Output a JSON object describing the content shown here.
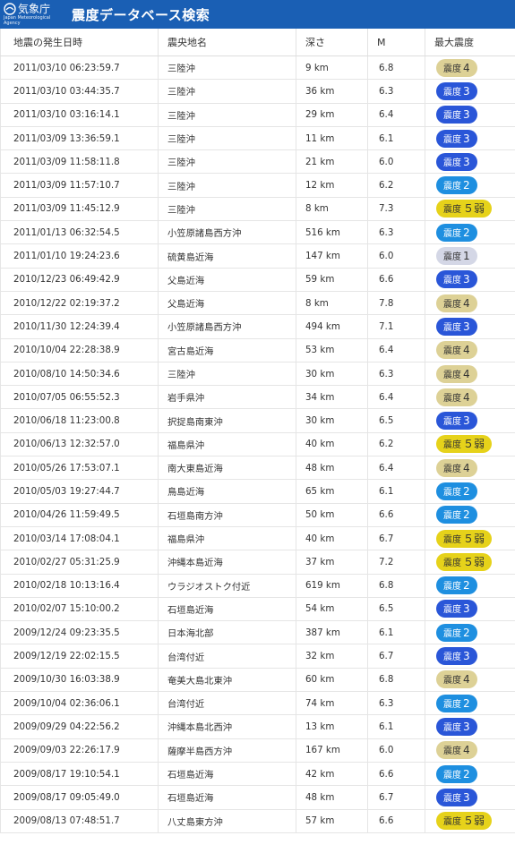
{
  "header": {
    "logo_text": "気象庁",
    "logo_sub": "Japan Meteorological Agency",
    "title": "震度データベース検索"
  },
  "table": {
    "columns": [
      "地震の発生日時",
      "震央地名",
      "深さ",
      "M",
      "最大震度"
    ],
    "rows": [
      {
        "datetime": "2011/03/10 06:23:59.7",
        "place": "三陸沖",
        "depth": "9 km",
        "mag": "6.8",
        "int_prefix": "震度",
        "int_num": "4",
        "level": 4
      },
      {
        "datetime": "2011/03/10 03:44:35.7",
        "place": "三陸沖",
        "depth": "36 km",
        "mag": "6.3",
        "int_prefix": "震度",
        "int_num": "3",
        "level": 3
      },
      {
        "datetime": "2011/03/10 03:16:14.1",
        "place": "三陸沖",
        "depth": "29 km",
        "mag": "6.4",
        "int_prefix": "震度",
        "int_num": "3",
        "level": 3
      },
      {
        "datetime": "2011/03/09 13:36:59.1",
        "place": "三陸沖",
        "depth": "11 km",
        "mag": "6.1",
        "int_prefix": "震度",
        "int_num": "3",
        "level": 3
      },
      {
        "datetime": "2011/03/09 11:58:11.8",
        "place": "三陸沖",
        "depth": "21 km",
        "mag": "6.0",
        "int_prefix": "震度",
        "int_num": "3",
        "level": 3
      },
      {
        "datetime": "2011/03/09 11:57:10.7",
        "place": "三陸沖",
        "depth": "12 km",
        "mag": "6.2",
        "int_prefix": "震度",
        "int_num": "2",
        "level": 2
      },
      {
        "datetime": "2011/03/09 11:45:12.9",
        "place": "三陸沖",
        "depth": "8 km",
        "mag": "7.3",
        "int_prefix": "震度",
        "int_num": "５弱",
        "level": 5
      },
      {
        "datetime": "2011/01/13 06:32:54.5",
        "place": "小笠原諸島西方沖",
        "depth": "516 km",
        "mag": "6.3",
        "int_prefix": "震度",
        "int_num": "2",
        "level": 2
      },
      {
        "datetime": "2011/01/10 19:24:23.6",
        "place": "硫黄島近海",
        "depth": "147 km",
        "mag": "6.0",
        "int_prefix": "震度",
        "int_num": "1",
        "level": 1
      },
      {
        "datetime": "2010/12/23 06:49:42.9",
        "place": "父島近海",
        "depth": "59 km",
        "mag": "6.6",
        "int_prefix": "震度",
        "int_num": "3",
        "level": 3
      },
      {
        "datetime": "2010/12/22 02:19:37.2",
        "place": "父島近海",
        "depth": "8 km",
        "mag": "7.8",
        "int_prefix": "震度",
        "int_num": "4",
        "level": 4
      },
      {
        "datetime": "2010/11/30 12:24:39.4",
        "place": "小笠原諸島西方沖",
        "depth": "494 km",
        "mag": "7.1",
        "int_prefix": "震度",
        "int_num": "3",
        "level": 3
      },
      {
        "datetime": "2010/10/04 22:28:38.9",
        "place": "宮古島近海",
        "depth": "53 km",
        "mag": "6.4",
        "int_prefix": "震度",
        "int_num": "4",
        "level": 4
      },
      {
        "datetime": "2010/08/10 14:50:34.6",
        "place": "三陸沖",
        "depth": "30 km",
        "mag": "6.3",
        "int_prefix": "震度",
        "int_num": "4",
        "level": 4
      },
      {
        "datetime": "2010/07/05 06:55:52.3",
        "place": "岩手県沖",
        "depth": "34 km",
        "mag": "6.4",
        "int_prefix": "震度",
        "int_num": "4",
        "level": 4
      },
      {
        "datetime": "2010/06/18 11:23:00.8",
        "place": "択捉島南東沖",
        "depth": "30 km",
        "mag": "6.5",
        "int_prefix": "震度",
        "int_num": "3",
        "level": 3
      },
      {
        "datetime": "2010/06/13 12:32:57.0",
        "place": "福島県沖",
        "depth": "40 km",
        "mag": "6.2",
        "int_prefix": "震度",
        "int_num": "５弱",
        "level": 5
      },
      {
        "datetime": "2010/05/26 17:53:07.1",
        "place": "南大東島近海",
        "depth": "48 km",
        "mag": "6.4",
        "int_prefix": "震度",
        "int_num": "4",
        "level": 4
      },
      {
        "datetime": "2010/05/03 19:27:44.7",
        "place": "鳥島近海",
        "depth": "65 km",
        "mag": "6.1",
        "int_prefix": "震度",
        "int_num": "2",
        "level": 2
      },
      {
        "datetime": "2010/04/26 11:59:49.5",
        "place": "石垣島南方沖",
        "depth": "50 km",
        "mag": "6.6",
        "int_prefix": "震度",
        "int_num": "2",
        "level": 2
      },
      {
        "datetime": "2010/03/14 17:08:04.1",
        "place": "福島県沖",
        "depth": "40 km",
        "mag": "6.7",
        "int_prefix": "震度",
        "int_num": "５弱",
        "level": 5
      },
      {
        "datetime": "2010/02/27 05:31:25.9",
        "place": "沖縄本島近海",
        "depth": "37 km",
        "mag": "7.2",
        "int_prefix": "震度",
        "int_num": "５弱",
        "level": 5
      },
      {
        "datetime": "2010/02/18 10:13:16.4",
        "place": "ウラジオストク付近",
        "depth": "619 km",
        "mag": "6.8",
        "int_prefix": "震度",
        "int_num": "2",
        "level": 2
      },
      {
        "datetime": "2010/02/07 15:10:00.2",
        "place": "石垣島近海",
        "depth": "54 km",
        "mag": "6.5",
        "int_prefix": "震度",
        "int_num": "3",
        "level": 3
      },
      {
        "datetime": "2009/12/24 09:23:35.5",
        "place": "日本海北部",
        "depth": "387 km",
        "mag": "6.1",
        "int_prefix": "震度",
        "int_num": "2",
        "level": 2
      },
      {
        "datetime": "2009/12/19 22:02:15.5",
        "place": "台湾付近",
        "depth": "32 km",
        "mag": "6.7",
        "int_prefix": "震度",
        "int_num": "3",
        "level": 3
      },
      {
        "datetime": "2009/10/30 16:03:38.9",
        "place": "奄美大島北東沖",
        "depth": "60 km",
        "mag": "6.8",
        "int_prefix": "震度",
        "int_num": "4",
        "level": 4
      },
      {
        "datetime": "2009/10/04 02:36:06.1",
        "place": "台湾付近",
        "depth": "74 km",
        "mag": "6.3",
        "int_prefix": "震度",
        "int_num": "2",
        "level": 2
      },
      {
        "datetime": "2009/09/29 04:22:56.2",
        "place": "沖縄本島北西沖",
        "depth": "13 km",
        "mag": "6.1",
        "int_prefix": "震度",
        "int_num": "3",
        "level": 3
      },
      {
        "datetime": "2009/09/03 22:26:17.9",
        "place": "薩摩半島西方沖",
        "depth": "167 km",
        "mag": "6.0",
        "int_prefix": "震度",
        "int_num": "4",
        "level": 4
      },
      {
        "datetime": "2009/08/17 19:10:54.1",
        "place": "石垣島近海",
        "depth": "42 km",
        "mag": "6.6",
        "int_prefix": "震度",
        "int_num": "2",
        "level": 2
      },
      {
        "datetime": "2009/08/17 09:05:49.0",
        "place": "石垣島近海",
        "depth": "48 km",
        "mag": "6.7",
        "int_prefix": "震度",
        "int_num": "3",
        "level": 3
      },
      {
        "datetime": "2009/08/13 07:48:51.7",
        "place": "八丈島東方沖",
        "depth": "57 km",
        "mag": "6.6",
        "int_prefix": "震度",
        "int_num": "５弱",
        "level": 5
      }
    ]
  }
}
